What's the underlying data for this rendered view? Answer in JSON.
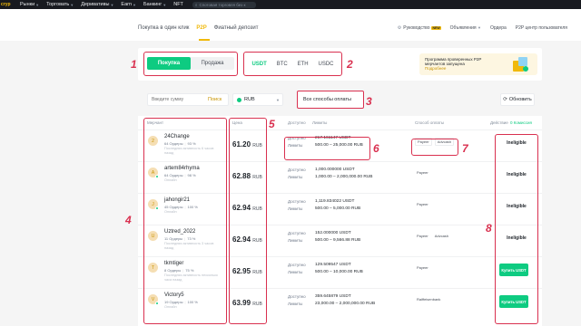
{
  "topnav": {
    "logo": "cryp",
    "items": [
      "Рынки",
      "Торговать",
      "Деривативы",
      "Earn",
      "Банкинг",
      "NFT"
    ],
    "search_placeholder": "Спотовая торговля без к"
  },
  "subnav": {
    "left": [
      {
        "label": "Покупка в один клик",
        "active": false
      },
      {
        "label": "P2P",
        "active": true
      },
      {
        "label": "Фиатный депозит",
        "active": false
      }
    ],
    "guide": "Руководство",
    "new_badge": "NEW",
    "right": [
      "Объявления",
      "Ордера",
      "P2P центр пользователя"
    ]
  },
  "trade": {
    "buy": "Покупка",
    "sell": "Продажа",
    "assets": [
      "USDT",
      "BTC",
      "ETH",
      "USDC"
    ],
    "active_asset": "USDT"
  },
  "promo": {
    "line1": "Программа проверенных P2P",
    "line2": "мерчантов запущена",
    "line3": "Подробнее"
  },
  "filters": {
    "amount_placeholder": "Введите сумму",
    "search_label": "Поиск",
    "currency": "RUB",
    "payment": "Все способы оплаты",
    "refresh": "Обновить"
  },
  "table": {
    "headers": {
      "advertiser": "Мерчант",
      "price": "Цена",
      "available": "Доступно",
      "limits": "Лимиты",
      "payment": "Способ оплаты",
      "action": "Действие",
      "fee": "0 Комиссия"
    },
    "available_label": "Доступно",
    "limits_label": "Лимиты",
    "rows": [
      {
        "initial": "2",
        "name": "24Change",
        "orders": "64 Ордеры",
        "rate": "93 %",
        "status": "Последняя активность 6 часов назад",
        "price": "61.20",
        "currency": "RUB",
        "available": "217.161147 USDT",
        "limits": "500.00 – 25,000.00 RUB",
        "payments": [
          "Payeer",
          "Advcash"
        ],
        "action": "Ineligible"
      },
      {
        "initial": "A",
        "name": "artem84rhyma",
        "orders": "64 Ордеры",
        "rate": "98 %",
        "status": "Онлайн",
        "price": "62.88",
        "currency": "RUB",
        "available": "1,000.000000 USDT",
        "limits": "1,000.00 – 2,000,000.00 RUB",
        "payments": [
          "Payeer"
        ],
        "action": "Ineligible"
      },
      {
        "initial": "J",
        "name": "jahongir21",
        "orders": "45 Ордеры",
        "rate": "100 %",
        "status": "Онлайн",
        "price": "62.94",
        "currency": "RUB",
        "available": "1,119.834022 USDT",
        "limits": "500.00 – 5,000.00 RUB",
        "payments": [
          "Payeer"
        ],
        "action": "Ineligible"
      },
      {
        "initial": "U",
        "name": "Uztred_2022",
        "orders": "11 Ордеры",
        "rate": "73 %",
        "status": "Последняя активность 3 часов назад",
        "price": "62.94",
        "currency": "RUB",
        "available": "152.000000 USDT",
        "limits": "500.00 – 9,566.88 RUB",
        "payments": [
          "Payeer",
          "Advcash"
        ],
        "action": "Ineligible"
      },
      {
        "initial": "T",
        "name": "tkmtiger",
        "orders": "8 Ордеры",
        "rate": "75 %",
        "status": "Последняя активность несколько часа назад",
        "price": "62.95",
        "currency": "RUB",
        "available": "129.509547 USDT",
        "limits": "500.00 – 10,000.00 RUB",
        "payments": [
          "Payeer"
        ],
        "action": "Купить USDT"
      },
      {
        "initial": "V",
        "name": "Victory5",
        "orders": "19 Ордеры",
        "rate": "100 %",
        "status": "Онлайн",
        "price": "63.99",
        "currency": "RUB",
        "available": "359.645879 USDT",
        "limits": "23,000.00 – 2,000,000.00 RUB",
        "payments": [
          "Raiffeisenbank"
        ],
        "action": "Купить USDT"
      }
    ]
  },
  "annotations": [
    "1",
    "2",
    "3",
    "4",
    "5",
    "6",
    "7",
    "8"
  ],
  "colors": {
    "accent": "#f0b90b",
    "buy": "#0ecb81",
    "annotation": "#d9304f"
  }
}
